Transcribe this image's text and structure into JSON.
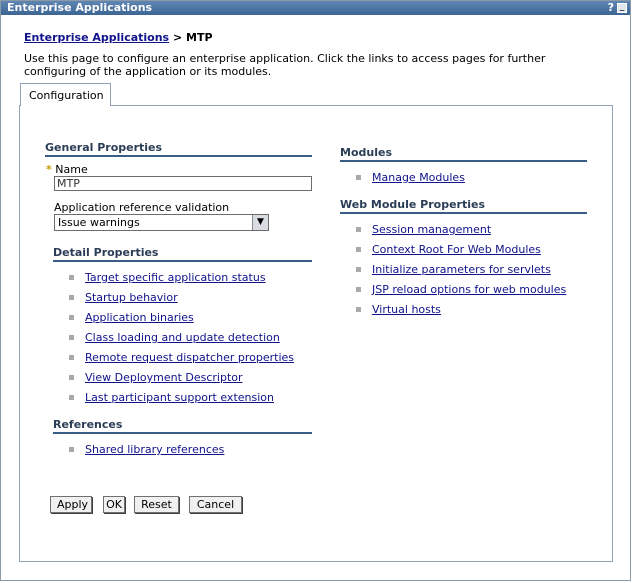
{
  "window": {
    "title": "Enterprise Applications",
    "help_label": "?",
    "minimize_label": "_"
  },
  "breadcrumb": {
    "link": "Enterprise Applications",
    "separator": ">",
    "current": "MTP"
  },
  "intro": "Use this page to configure an enterprise application. Click the links to access pages for further configuring of the application or its modules.",
  "tab": {
    "label": "Configuration"
  },
  "general": {
    "heading": "General Properties",
    "required_marker": "*",
    "name_label": "Name",
    "name_value": "MTP",
    "validation_label": "Application reference validation",
    "validation_value": "Issue warnings"
  },
  "detail": {
    "heading": "Detail Properties",
    "items": [
      "Target specific application status",
      "Startup behavior",
      "Application binaries",
      "Class loading and update detection",
      "Remote request dispatcher properties",
      "View Deployment Descriptor",
      "Last participant support extension"
    ]
  },
  "references": {
    "heading": "References",
    "items": [
      "Shared library references"
    ]
  },
  "modules": {
    "heading": "Modules",
    "items": [
      "Manage Modules"
    ]
  },
  "web_module": {
    "heading": "Web Module Properties",
    "items": [
      "Session management",
      "Context Root For Web Modules",
      "Initialize parameters for servlets",
      "JSP reload options for web modules",
      "Virtual hosts"
    ]
  },
  "buttons": {
    "apply": "Apply",
    "ok": "OK",
    "reset": "Reset",
    "cancel": "Cancel"
  },
  "colors": {
    "titlebar": "#3c6595",
    "link": "#10138a",
    "section_rule": "#385e85",
    "required": "#c89a00"
  }
}
